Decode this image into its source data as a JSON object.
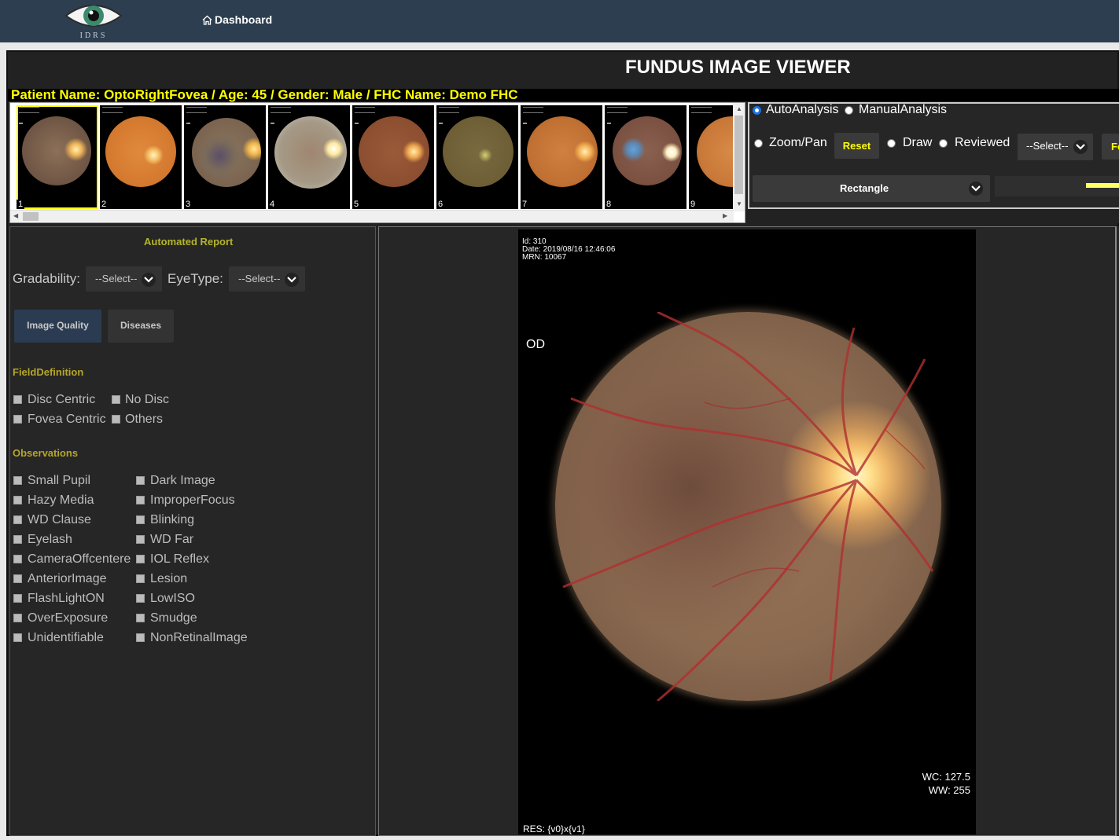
{
  "nav": {
    "logo_text": "IDRS",
    "dashboard_label": "Dashboard"
  },
  "viewer": {
    "title": "FUNDUS IMAGE VIEWER",
    "patient_info": "Patient Name: OptoRightFovea /  Age: 45 /  Gender: Male /  FHC Name: Demo FHC"
  },
  "thumbnails": [
    {
      "num": "1",
      "selected": true
    },
    {
      "num": "2"
    },
    {
      "num": "3"
    },
    {
      "num": "4"
    },
    {
      "num": "5"
    },
    {
      "num": "6"
    },
    {
      "num": "7"
    },
    {
      "num": "8"
    },
    {
      "num": "9"
    }
  ],
  "controls": {
    "auto_analysis": "AutoAnalysis",
    "manual_analysis": "ManualAnalysis",
    "zoom_pan": "Zoom/Pan",
    "reset": "Reset",
    "draw": "Draw",
    "reviewed": "Reviewed",
    "select_placeholder": "--Select--",
    "partial_button": "Fe",
    "shape_selected": "Rectangle"
  },
  "report": {
    "title": "Automated Report",
    "gradability_label": "Gradability:",
    "gradability_value": "--Select--",
    "eyetype_label": "EyeType:",
    "eyetype_value": "--Select--",
    "tabs": [
      "Image Quality",
      "Diseases"
    ],
    "field_definition_title": "FieldDefinition",
    "field_definition": [
      "Disc Centric",
      "No Disc",
      "Fovea Centric",
      "Others"
    ],
    "observations_title": "Observations",
    "observations_col1": [
      "Small Pupil",
      "Hazy Media",
      "WD Clause",
      "Eyelash",
      "CameraOffcentere",
      "AnteriorImage",
      "FlashLightON",
      "OverExposure",
      "Unidentifiable"
    ],
    "observations_col2": [
      "Dark Image",
      "ImproperFocus",
      "Blinking",
      "WD Far",
      "IOL Reflex",
      "Lesion",
      "LowISO",
      "Smudge",
      "NonRetinalImage"
    ]
  },
  "image": {
    "id_line": "Id: 310",
    "date_line": "Date: 2019/08/16 12:46:06",
    "mrn_line": "MRN: 10067",
    "eye": "OD",
    "wc": "WC: 127.5",
    "ww": "WW: 255",
    "res": "RES: {v0}x{v1}"
  },
  "colors": {
    "nav_bg": "#2c3e50",
    "accent_yellow": "#ffff00",
    "panel_bg": "#262626",
    "section_title": "#b5a52a"
  }
}
